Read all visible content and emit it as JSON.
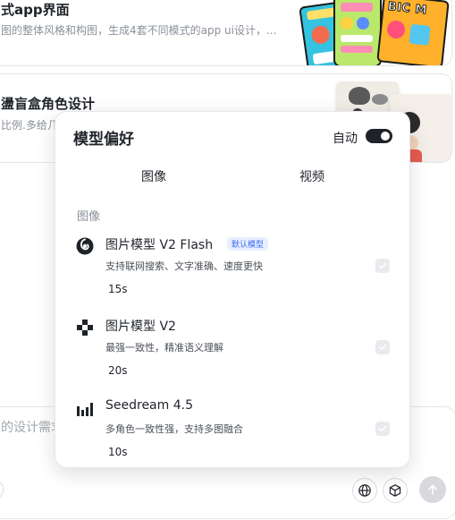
{
  "background_cards": [
    {
      "title": "式app界面",
      "desc": "图的整体风格和构图，生成4套不同模式的app ui设计，..."
    },
    {
      "title": "盪盲盒角色设计",
      "desc": "比例.多给几"
    }
  ],
  "thumbnail_texts": {
    "card1_right": "BIC M"
  },
  "input": {
    "placeholder": "的设计需求"
  },
  "popover": {
    "title": "模型偏好",
    "auto_label": "自动",
    "auto_enabled": true,
    "tabs": [
      "图像",
      "视频"
    ],
    "section_label": "图像",
    "models": [
      {
        "name": "图片模型 V2 Flash",
        "badge": "默认模型",
        "desc": "支持联网搜索、文字准确、速度更快",
        "time": "15s",
        "icon": "swirl-logo-icon",
        "checked": false
      },
      {
        "name": "图片模型 V2",
        "desc": "最强一致性，精准语义理解",
        "time": "20s",
        "icon": "pixel-diamond-icon",
        "checked": false
      },
      {
        "name": "Seedream 4.5",
        "desc": "多角色一致性强，支持多图融合",
        "time": "10s",
        "icon": "bars-logo-icon",
        "checked": false
      }
    ]
  },
  "colors": {
    "accent_dark": "#1f2329",
    "badge_text": "#3a6df0",
    "badge_bg": "#e8efff",
    "muted": "#8a8f99"
  }
}
